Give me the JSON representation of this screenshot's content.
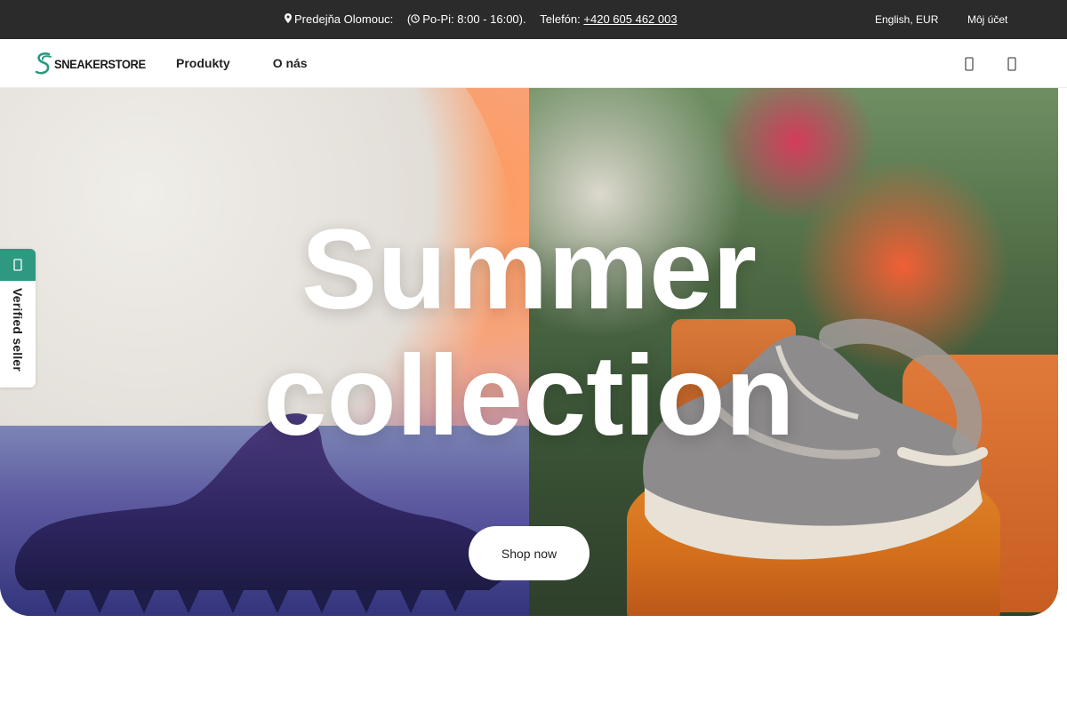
{
  "topbar": {
    "store": "Predejňa Olomouc:",
    "hours": "Po-Pi: 8:00 - 16:00).",
    "hours_prefix": "(",
    "phone_label": "Telefón:",
    "phone": "+420 605 462 003",
    "language": "English, EUR",
    "account": "Môj účet",
    "icons": [
      "location-icon",
      "clock-icon"
    ]
  },
  "header": {
    "logo_text": "SNEAKERSTORE",
    "nav": [
      "Produkty",
      "O nás"
    ],
    "icons": [
      "search-icon",
      "cart-icon"
    ]
  },
  "hero": {
    "title_line1": "Summer",
    "title_line2": "collection",
    "cta": "Shop now"
  },
  "verified": {
    "label": "Verified seller",
    "icon": "shield-check-icon"
  },
  "colors": {
    "topbar_bg": "#2b2b2b",
    "accent": "#2e9980",
    "text": "#222222"
  }
}
